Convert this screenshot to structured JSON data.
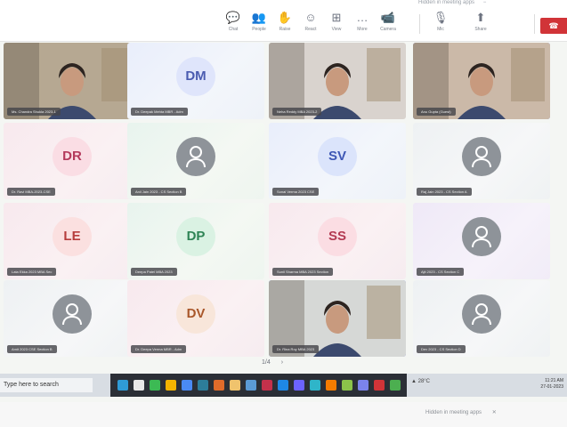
{
  "colors": {
    "accent": "#7b83eb",
    "leave": "#d13438",
    "taskbar": "#2b2f36"
  },
  "top_hint": {
    "left": "Hidden in meeting apps",
    "right": "−"
  },
  "toolbar": [
    {
      "id": "chat",
      "icon": "chat-icon",
      "glyph": "💬",
      "label": "Chat"
    },
    {
      "id": "people",
      "icon": "people-icon",
      "glyph": "👥",
      "label": "People"
    },
    {
      "id": "raise",
      "icon": "hand-icon",
      "glyph": "✋",
      "label": "Raise"
    },
    {
      "id": "react",
      "icon": "smile-icon",
      "glyph": "☺",
      "label": "React"
    },
    {
      "id": "view",
      "icon": "grid-icon",
      "glyph": "⊞",
      "label": "View"
    },
    {
      "id": "more",
      "icon": "more-icon",
      "glyph": "…",
      "label": "More"
    },
    {
      "id": "camera",
      "icon": "camera-icon",
      "glyph": "📹",
      "label": "Camera"
    },
    {
      "id": "mic",
      "icon": "mic-icon",
      "glyph": "🎙",
      "label": "Mic"
    },
    {
      "id": "share",
      "icon": "share-icon",
      "glyph": "⬆",
      "label": "Share"
    }
  ],
  "leave": {
    "glyph": "☎"
  },
  "tiles": [
    {
      "type": "video",
      "name": "Ms. Chandra Shukla 2023-1",
      "color": "c-gray"
    },
    {
      "type": "initials",
      "initials": "DM",
      "av": "av-dm",
      "name": "Dr. Deepak Mehta MBR - Adm",
      "color": "c-blue"
    },
    {
      "type": "video",
      "name": "Neha Reddy MBA 2023-2",
      "color": "c-gray"
    },
    {
      "type": "video",
      "name": "Anu Gupta (Guest)",
      "color": "c-lilac",
      "speaking": true
    },
    {
      "type": "initials",
      "initials": "DR",
      "av": "av-dr",
      "name": "Dr. Ravi MBA-2023-CSE",
      "color": "c-pink"
    },
    {
      "type": "icon",
      "name": "Anil Jain 2023 - CS Section B",
      "color": "c-mint"
    },
    {
      "type": "initials",
      "initials": "SV",
      "av": "av-sv",
      "name": "Sonal Verma 2023 CSE",
      "color": "c-blue"
    },
    {
      "type": "icon",
      "name": "Raj Jain 2023 - CS Section A",
      "color": "c-gray"
    },
    {
      "type": "initials",
      "initials": "LE",
      "av": "av-le",
      "name": "Lata Ekka 2023 MBA Sec",
      "color": "c-pink"
    },
    {
      "type": "initials",
      "initials": "DP",
      "av": "av-dp",
      "name": "Deepa Patel MBA 2023",
      "color": "c-mint"
    },
    {
      "type": "initials",
      "initials": "SS",
      "av": "av-ss",
      "name": "Sunil Sharma MBA 2023 Section",
      "color": "c-pink"
    },
    {
      "type": "icon",
      "name": "Ajit 2023 - CS Section C",
      "color": "c-lilac"
    },
    {
      "type": "icon",
      "name": "Amit 2023 CSE Section B",
      "color": "c-gray"
    },
    {
      "type": "initials",
      "initials": "DV",
      "av": "av-dv",
      "name": "Dr. Deepa Verma MBR - Adm",
      "color": "c-pink"
    },
    {
      "type": "video",
      "name": "Dr. Rina Roy MBA 2023",
      "color": "c-gray",
      "speaking": true
    },
    {
      "type": "icon",
      "name": "Dev 2023 - CS Section D",
      "color": "c-gray"
    }
  ],
  "pager": {
    "page": "1/4",
    "next": "›"
  },
  "taskbar": {
    "search": "Type here to search",
    "tray": "▲ 28°C",
    "time": "11:21 AM",
    "date": "27-01-2023"
  },
  "bottom": {
    "hint": "Hidden in meeting apps",
    "close": "✕"
  }
}
